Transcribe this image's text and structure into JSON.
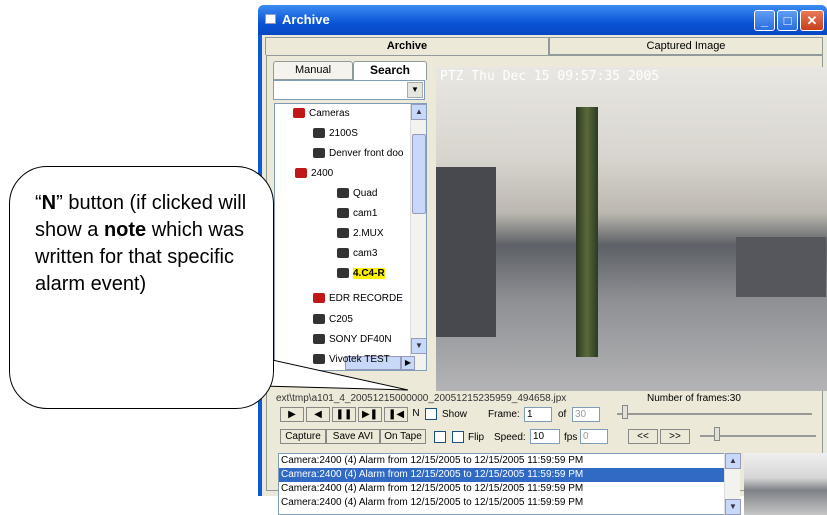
{
  "window": {
    "title": "Archive",
    "min": "_",
    "max": "□",
    "close": "✕"
  },
  "tabs": {
    "archive": "Archive",
    "captured": "Captured Image"
  },
  "subtabs": {
    "manual": "Manual",
    "search": "Search"
  },
  "combo": {
    "value": ""
  },
  "tree": [
    {
      "label": "Cameras",
      "kind": "root"
    },
    {
      "label": "2100S",
      "kind": "cam"
    },
    {
      "label": "Denver front doo",
      "kind": "cam"
    },
    {
      "label": "2400",
      "kind": "red"
    },
    {
      "label": "Quad",
      "kind": "cam"
    },
    {
      "label": "cam1",
      "kind": "cam"
    },
    {
      "label": "2.MUX",
      "kind": "cam"
    },
    {
      "label": "cam3",
      "kind": "cam"
    },
    {
      "label": "4.C4-R",
      "kind": "cam"
    },
    {
      "label": "EDR RECORDE",
      "kind": "red"
    },
    {
      "label": "C205",
      "kind": "cam"
    },
    {
      "label": "SONY DF40N",
      "kind": "cam"
    },
    {
      "label": "Vivotek TEST",
      "kind": "cam"
    }
  ],
  "video": {
    "caption": "PTZ  Thu Dec 15  09:57:35  2005"
  },
  "archive": {
    "path": "ext\\tmp\\a101_4_20051215000000_20051215235959_494658.jpx",
    "frames": "Number of frames:30"
  },
  "controls": {
    "play": "▶",
    "back": "◀",
    "pause": "❚❚",
    "next": "▶❚",
    "last": "❚◀",
    "n": "N",
    "show": "Show",
    "frame_label": "Frame:",
    "frame_value": "1",
    "of": "of",
    "total": "30",
    "capture": "Capture",
    "save_avi": "Save AVI",
    "on_tape": "On Tape",
    "flip": "Flip",
    "speed_label": "Speed:",
    "speed_value": "10",
    "fps": "fps",
    "fps_value": "0",
    "rew": "<<",
    "ff": ">>"
  },
  "alarms": [
    "Camera:2400 (4) Alarm from 12/15/2005 to 12/15/2005 11:59:59 PM",
    "Camera:2400 (4) Alarm from 12/15/2005 to 12/15/2005 11:59:59 PM",
    "Camera:2400 (4) Alarm from 12/15/2005 to 12/15/2005 11:59:59 PM",
    "Camera:2400 (4) Alarm from 12/15/2005 to 12/15/2005 11:59:59 PM"
  ],
  "callout": {
    "q1": "“",
    "n": "N",
    "q2": "”",
    "t1": " button (if clicked will show a ",
    "note": "note",
    "t2": " which was written for that specific alarm event)"
  }
}
